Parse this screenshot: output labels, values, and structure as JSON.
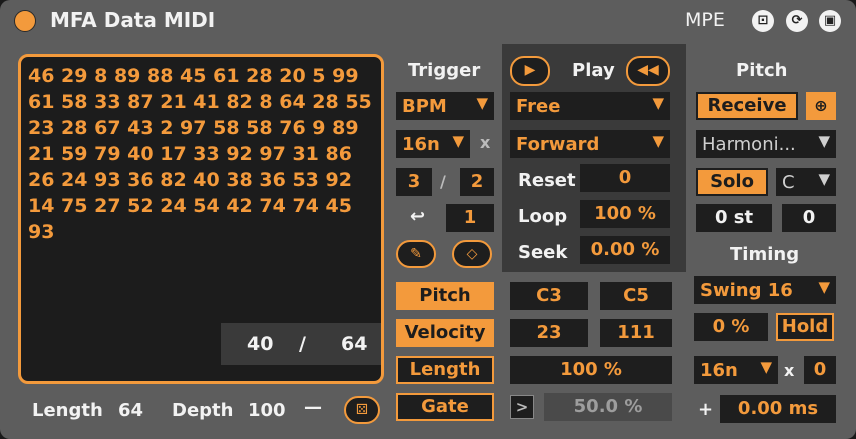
{
  "title": "MFA Data MIDI",
  "mpe": "MPE",
  "sequence": "46 29 8 89 88 45 61 28 20 5 99\n61 58 33 87 21 41 82 8 64 28 55\n23 28 67 43 2 97 58 58 76 9 89\n21 59 79 40 17 33 92 97 31 86\n26 24 93 36 82 40 38 36 53 92\n14 75 27 52 24 54 42 74 74 45\n93",
  "position": {
    "current": "40",
    "separator": "/",
    "total": "64"
  },
  "footer": {
    "length_label": "Length",
    "length_value": "64",
    "depth_label": "Depth",
    "depth_value": "100",
    "dash": "—"
  },
  "trigger": {
    "header": "Trigger",
    "mode": "BPM",
    "rate": "16n",
    "x": "x",
    "num": "3",
    "slash": "/",
    "den": "2",
    "loop_arrow": "↩",
    "loop_value": "1"
  },
  "play": {
    "header": "Play",
    "mode": "Free",
    "direction": "Forward",
    "reset_label": "Reset",
    "reset_value": "0",
    "loop_label": "Loop",
    "loop_value": "100 %",
    "seek_label": "Seek",
    "seek_value": "0.00 %"
  },
  "targets": {
    "pitch": "Pitch",
    "velocity": "Velocity",
    "length": "Length",
    "gate": "Gate"
  },
  "ranges": {
    "pitch_min": "C3",
    "pitch_max": "C5",
    "vel_min": "23",
    "vel_max": "111",
    "length_value": "100 %",
    "gate_arrow": ">",
    "gate_value": "50.0 %"
  },
  "pitch": {
    "header": "Pitch",
    "receive": "Receive",
    "scale": "Harmoni...",
    "solo": "Solo",
    "key": "C",
    "st": "0 st",
    "offset": "0"
  },
  "timing": {
    "header": "Timing",
    "swing": "Swing 16",
    "swing_amount": "0 %",
    "hold": "Hold",
    "rate": "16n",
    "x": "x",
    "mult": "0",
    "plus": "+",
    "ms": "0.00 ms"
  },
  "colors": {
    "accent": "#f39a3c",
    "body": "#5d5d5d",
    "field": "#1e1e1e"
  }
}
